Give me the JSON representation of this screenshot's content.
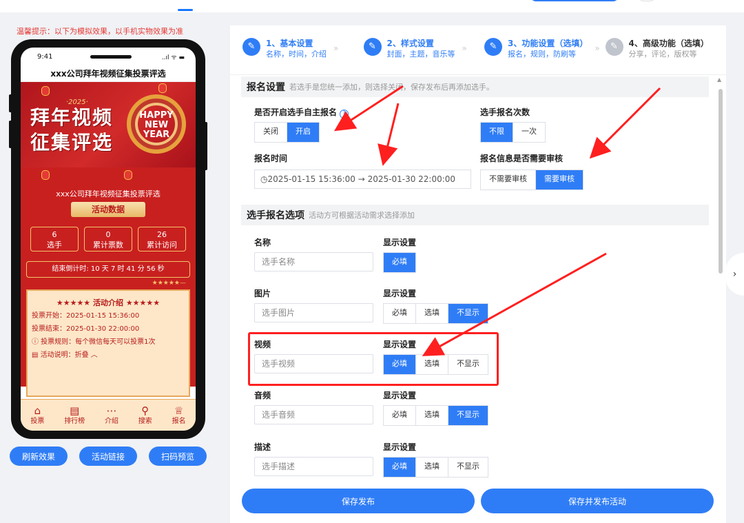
{
  "hint": "温馨提示：以下为模拟效果，以手机实物效果为准",
  "phone": {
    "time": "9:41",
    "signal": "..ıl ᯤ ▬",
    "title": "xxx公司拜年视频征集投票评选",
    "banner_text_1": "拜年视频",
    "banner_text_2": "征集评选",
    "banner_year": "·2025·",
    "banner_hny": "HAPPY NEW YEAR",
    "activity_title": "xxx公司拜年视频征集投票评选",
    "ribbon": "活动数据",
    "stats": [
      {
        "value": "6",
        "label": "选手"
      },
      {
        "value": "0",
        "label": "累计票数"
      },
      {
        "value": "26",
        "label": "累计访问"
      }
    ],
    "countdown": "结束倒计时:  10 天 7 时 41 分 56 秒",
    "stars": "★★★★★—",
    "intro_title": "★★★★★ 活动介绍 ★★★★★",
    "intro_lines": [
      "投票开始：2025-01-15 15:36:00",
      "投票结束：2025-01-30 22:00:00",
      "ⓘ 投票规则：每个微信每天可以投票1次",
      "▤ 活动说明：折叠 ︿"
    ],
    "nav": [
      {
        "icon": "⌂",
        "label": "投票"
      },
      {
        "icon": "▤",
        "label": "排行榜"
      },
      {
        "icon": "⋯",
        "label": "介绍"
      },
      {
        "icon": "⚲",
        "label": "搜索"
      },
      {
        "icon": "♕",
        "label": "报名"
      }
    ]
  },
  "phone_buttons": [
    "刷新效果",
    "活动链接",
    "扫码预览"
  ],
  "steps": [
    {
      "num": "1、基本设置",
      "sub": "名称，时间，介绍"
    },
    {
      "num": "2、样式设置",
      "sub": "封面，主题，音乐等"
    },
    {
      "num": "3、功能设置（选填）",
      "sub": "报名，规则，防刷等"
    },
    {
      "num": "4、高级功能（选填）",
      "sub": "分享，评论，版权等"
    }
  ],
  "signup": {
    "title": "报名设置",
    "desc": "若选手是您统一添加，则选择关闭，保存发布后再添加选手。",
    "self_signup_label": "是否开启选手自主报名",
    "self_signup_options": [
      "关闭",
      "开启"
    ],
    "count_label": "选手报名次数",
    "count_options": [
      "不限",
      "一次"
    ],
    "time_label": "报名时间",
    "time_value": "◷2025-01-15 15:36:00  →  2025-01-30 22:00:00",
    "review_label": "报名信息是否需要审核",
    "review_options": [
      "不需要审核",
      "需要审核"
    ]
  },
  "options_section": {
    "title": "选手报名选项",
    "desc": "活动方可根据活动需求选择添加",
    "display_label": "显示设置",
    "fields": [
      {
        "label": "名称",
        "placeholder": "选手名称",
        "options": [
          "必填"
        ],
        "selected": 0
      },
      {
        "label": "图片",
        "placeholder": "选手图片",
        "options": [
          "必填",
          "选填",
          "不显示"
        ],
        "selected": 2
      },
      {
        "label": "视频",
        "placeholder": "选手视频",
        "options": [
          "必填",
          "选填",
          "不显示"
        ],
        "selected": 0
      },
      {
        "label": "音频",
        "placeholder": "选手音频",
        "options": [
          "必填",
          "选填",
          "不显示"
        ],
        "selected": 2
      },
      {
        "label": "描述",
        "placeholder": "选手描述",
        "options": [
          "必填",
          "选填",
          "不显示"
        ],
        "selected": 0
      }
    ]
  },
  "bottom_buttons": [
    "保存发布",
    "保存并发布活动"
  ],
  "colors": {
    "primary": "#2f7df6",
    "highlight": "#ff1f1f",
    "festive_red": "#c8201f"
  }
}
